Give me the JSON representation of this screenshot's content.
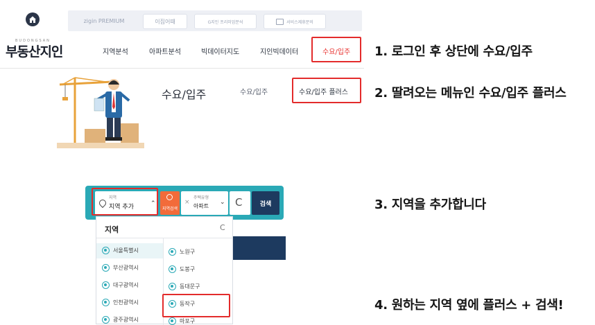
{
  "top_tabs": [
    {
      "label": "zigin PREMIUM"
    },
    {
      "label": "이집어때"
    },
    {
      "label": "G지인 프리미엄분석"
    },
    {
      "label": "서비스제휴문의"
    }
  ],
  "nav": {
    "logo_small": "BUDONGSAN",
    "logo": "부동산지인",
    "items": [
      {
        "label": "지역분석"
      },
      {
        "label": "아파트분석"
      },
      {
        "label": "빅데이터지도"
      },
      {
        "label": "지인빅데이터"
      },
      {
        "label": "수요/입주"
      }
    ]
  },
  "submenu": {
    "title": "수요/입주",
    "links": [
      {
        "label": "수요/입주"
      },
      {
        "label": "수요/입주 플러스"
      }
    ]
  },
  "search": {
    "region_small": "지역",
    "region_label": "지역 추가",
    "map_button": "지역검색",
    "type_small": "주택유형",
    "type_value": "아파트",
    "search_button": "검색"
  },
  "dropdown": {
    "title": "지역",
    "left_items": [
      {
        "label": "서울특별시"
      },
      {
        "label": "부산광역시"
      },
      {
        "label": "대구광역시"
      },
      {
        "label": "인천광역시"
      },
      {
        "label": "광주광역시"
      }
    ],
    "right_items": [
      {
        "label": "노원구"
      },
      {
        "label": "도봉구"
      },
      {
        "label": "동대문구"
      },
      {
        "label": "동작구"
      },
      {
        "label": "마포구"
      }
    ]
  },
  "steps": [
    {
      "text": "1. 로그인 후 상단에 수요/입주"
    },
    {
      "text": "2. 딸려오는 메뉴인 수요/입주 플러스"
    },
    {
      "text": "3. 지역을 추가합니다"
    },
    {
      "text": "4. 원하는 지역 옆에 플러스 + 검색!"
    }
  ],
  "colors": {
    "highlight": "#e32b2b",
    "teal": "#2aa9b6",
    "navy": "#1d3a5f",
    "orange": "#f26b3a"
  }
}
